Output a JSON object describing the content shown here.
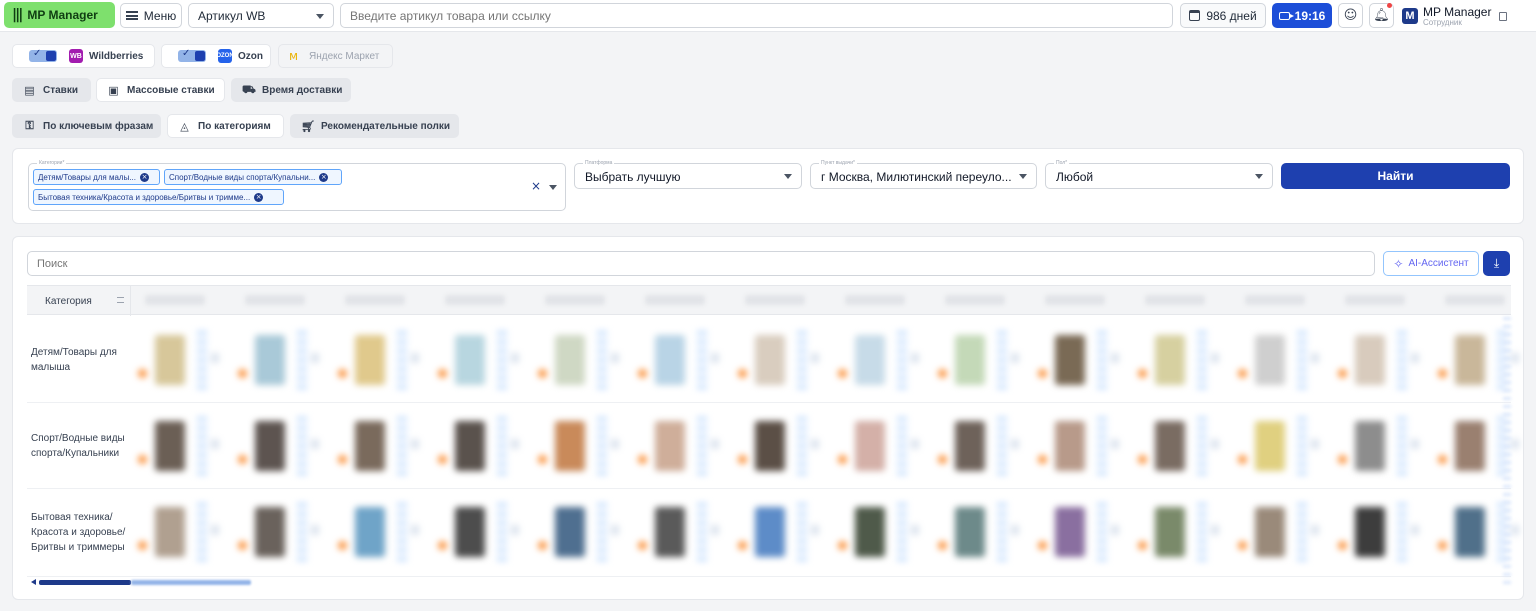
{
  "topbar": {
    "brand": "MP Manager",
    "menu_label": "Меню",
    "article_select": "Артикул WB",
    "search_placeholder": "Введите артикул товара или ссылку",
    "days_label": "986 дней",
    "timer": "19:16",
    "account_name": "MP Manager",
    "account_role": "Сотрудник",
    "account_initial": "M"
  },
  "marketplaces": [
    {
      "label": "Wildberries",
      "badge": "WB",
      "enabled": true
    },
    {
      "label": "Ozon",
      "badge": "OZON",
      "enabled": true
    },
    {
      "label": "Яндекс Маркет",
      "badge": "",
      "enabled": false
    }
  ],
  "tabs_row1": [
    {
      "label": "Ставки",
      "active": false
    },
    {
      "label": "Массовые ставки",
      "active": true
    },
    {
      "label": "Время доставки",
      "active": false
    }
  ],
  "tabs_row2": [
    {
      "label": "По ключевым фразам",
      "active": false
    },
    {
      "label": "По категориям",
      "active": true
    },
    {
      "label": "Рекомендательные полки",
      "active": false
    }
  ],
  "filters": {
    "categories_label": "Категории*",
    "chips": [
      "Детям/Товары для малы...",
      "Спорт/Водные виды спорта/Купальни...",
      "Бытовая техника/Красота и здоровье/Бритвы и тримме..."
    ],
    "platform_label": "Платформа",
    "platform_value": "Выбрать лучшую",
    "pickup_label": "Пункт выдачи*",
    "pickup_value": "г Москва, Милютинский переуло...",
    "sex_label": "Пол*",
    "sex_value": "Любой",
    "find_button": "Найти"
  },
  "results": {
    "search_placeholder": "Поиск",
    "ai_button": "AI-Ассистент",
    "category_header": "Категория",
    "rows": [
      "Детям/Товары для малыша",
      "Спорт/Водные виды спорта/Купальники",
      "Бытовая техника/Красота и здоровье/Бритвы и триммеры"
    ]
  },
  "colors": {
    "brand_green": "#7ee06d",
    "primary_blue": "#1e40af",
    "timer_blue": "#1d4ed8"
  }
}
